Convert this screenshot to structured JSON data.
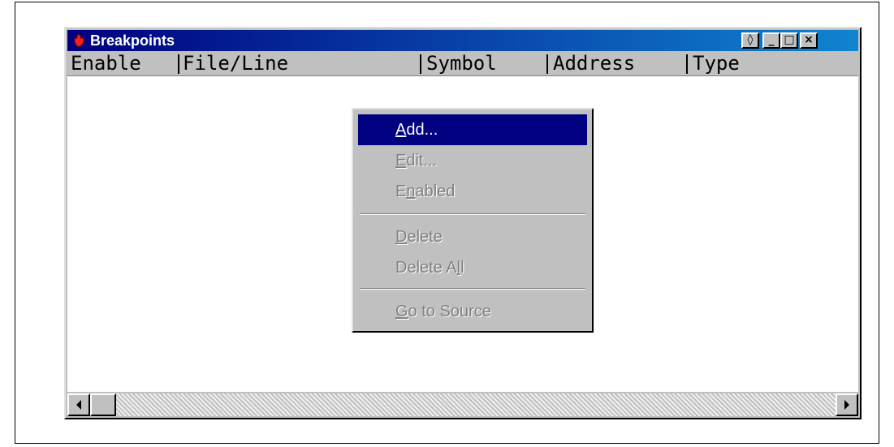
{
  "window": {
    "title": "Breakpoints",
    "controls": {
      "restore": "◊",
      "minimize": "_",
      "maximize": "□",
      "close": "×"
    }
  },
  "columns": [
    "Enable",
    "File/Line",
    "Symbol",
    "Address",
    "Type"
  ],
  "context_menu": {
    "items": [
      {
        "accel": "A",
        "rest": "dd...",
        "state": "highlighted"
      },
      {
        "accel": "E",
        "rest": "dit...",
        "state": "disabled"
      },
      {
        "pre": "E",
        "accel": "n",
        "rest": "abled",
        "state": "disabled"
      },
      {
        "accel": "D",
        "rest": "elete",
        "state": "disabled"
      },
      {
        "pre": "Delete A",
        "accel": "l",
        "rest": "l",
        "state": "disabled"
      },
      {
        "accel": "G",
        "rest": "o to Source",
        "state": "disabled"
      }
    ]
  },
  "scrollbar": {
    "left_arrow": "◀",
    "right_arrow": "▶"
  },
  "colors": {
    "title_start": "#000080",
    "title_end": "#1084d0",
    "highlight": "#000080",
    "face": "#c0c0c0"
  },
  "icons": [
    "breakpoint-app-icon",
    "scroll-left-icon",
    "scroll-right-icon"
  ]
}
